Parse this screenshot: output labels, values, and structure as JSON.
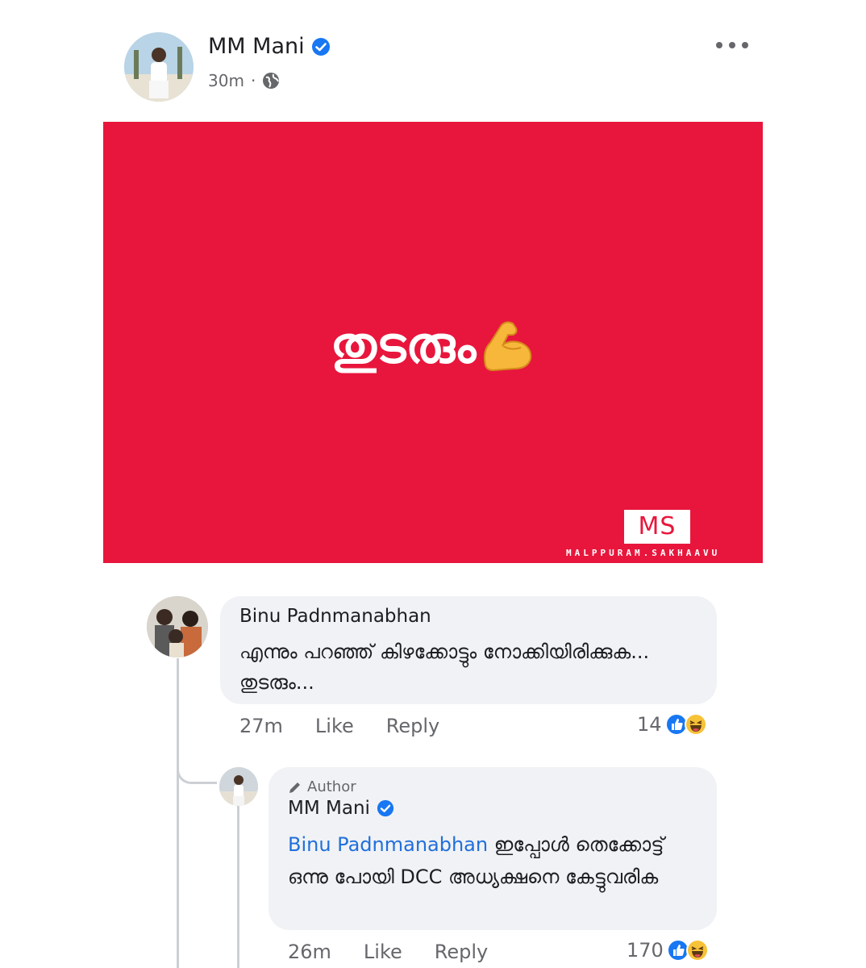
{
  "post": {
    "author": "MM Mani",
    "timestamp": "30m",
    "audience_icon": "globe-icon",
    "image": {
      "text": "തുടരും",
      "emoji": "flexed-biceps",
      "logo": "MS",
      "watermark": "MALPPURAM.SAKHAAVU",
      "background_color": "#e8163c"
    }
  },
  "comments": [
    {
      "author": "Binu Padnmanabhan",
      "text": "എന്നും പറഞ്ഞ് കിഴക്കോട്ടും നോക്കിയിരിക്കുക... തുടരും...",
      "timestamp": "27m",
      "like_label": "Like",
      "reply_label": "Reply",
      "reaction_count": "14",
      "reactions": [
        "like",
        "haha"
      ]
    },
    {
      "badge": "Author",
      "author": "MM Mani",
      "mention": "Binu Padnmanabhan",
      "text": "ഇപ്പോൾ തെക്കോട്ട് ഒന്നു പോയി DCC അധ്യക്ഷനെ കേട്ടുവരിക",
      "timestamp": "26m",
      "like_label": "Like",
      "reply_label": "Reply",
      "reaction_count": "170",
      "reactions": [
        "like",
        "haha"
      ]
    }
  ],
  "colors": {
    "verified_blue": "#1877f2",
    "mention_blue": "#216fdb",
    "bubble_gray": "#f0f2f5",
    "secondary_text": "#65676b"
  }
}
